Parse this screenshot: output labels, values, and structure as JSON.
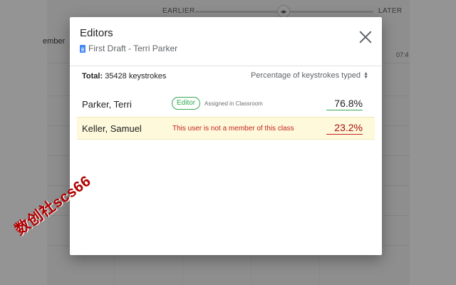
{
  "background": {
    "earlier_label": "EARLIER",
    "later_label": "LATER",
    "member_fragment": "ember",
    "time_fragment": "07:4",
    "slider_icon": "◂▸"
  },
  "modal": {
    "title": "Editors",
    "document_icon": "google-docs-icon",
    "document_title": "First Draft - Terri Parker",
    "close_icon": "close-icon",
    "total_label": "Total:",
    "total_value": "35428 keystrokes",
    "sort_label": "Percentage of keystrokes typed",
    "sort_icon": "sort-arrows-icon",
    "editors": [
      {
        "name": "Parker, Terri",
        "badge": "Editor",
        "note": "Assigned in Classroom",
        "percent": "76.8%"
      },
      {
        "name": "Keller, Samuel",
        "warning": "This user is not a member of this class",
        "percent": "23.2%"
      }
    ]
  },
  "watermark": "数创社scs66",
  "colors": {
    "accent_green": "#34a853",
    "warning_red": "#c5221f",
    "highlight_row": "#fef9db",
    "doc_blue": "#4285f4"
  }
}
